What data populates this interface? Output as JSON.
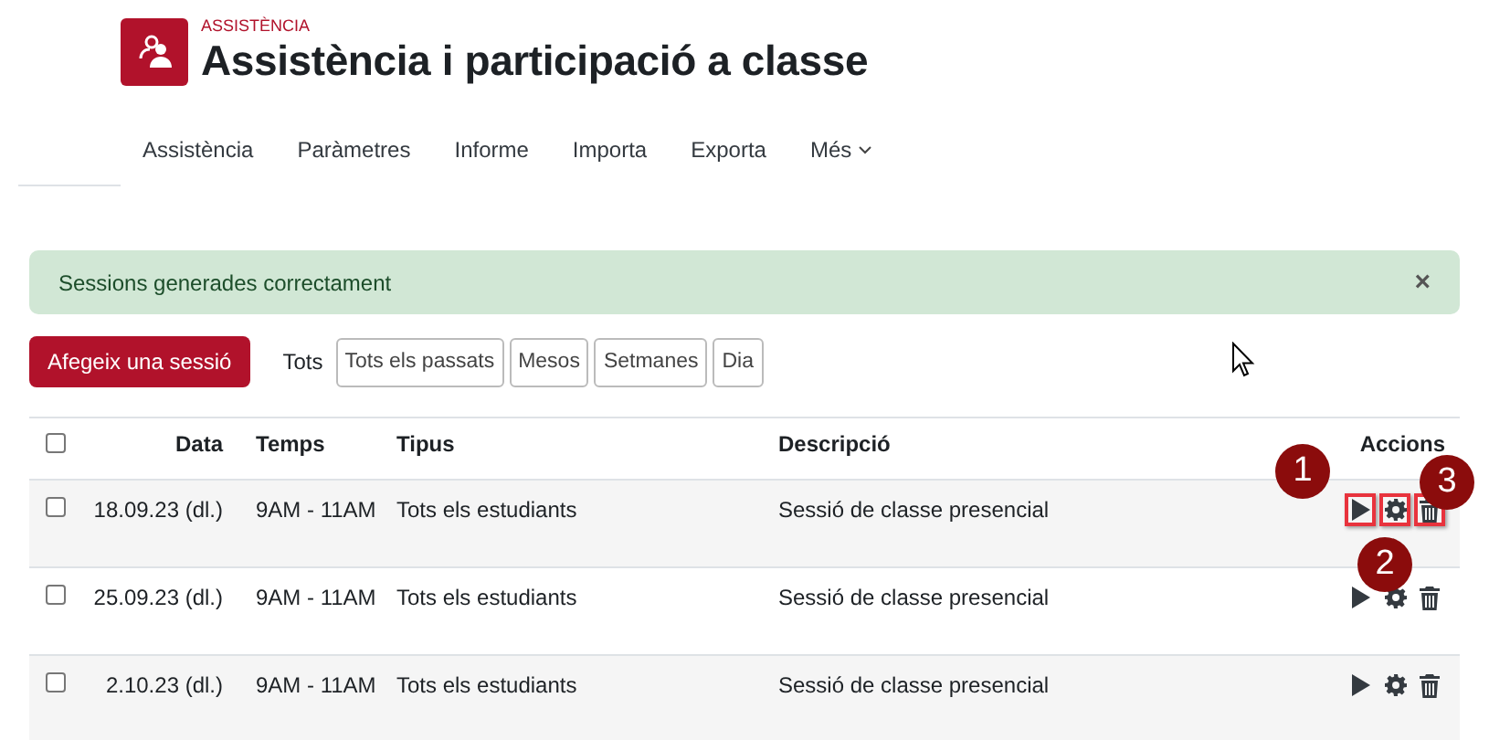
{
  "header": {
    "eyebrow": "ASSISTÈNCIA",
    "title": "Assistència i participació a classe"
  },
  "nav": [
    {
      "label": "Assistència",
      "dropdown": false
    },
    {
      "label": "Paràmetres",
      "dropdown": false
    },
    {
      "label": "Informe",
      "dropdown": false
    },
    {
      "label": "Importa",
      "dropdown": false
    },
    {
      "label": "Exporta",
      "dropdown": false
    },
    {
      "label": "Més",
      "dropdown": true
    }
  ],
  "alert": {
    "message": "Sessions generades correctament",
    "close": "×"
  },
  "toolbar": {
    "add_button": "Afegeix una sessió",
    "filter_label": "Tots",
    "filters": [
      {
        "label": "Tots els passats",
        "selected": false
      },
      {
        "label": "Mesos",
        "selected": false
      },
      {
        "label": "Setmanes",
        "selected": false
      },
      {
        "label": "Dia",
        "selected": false
      }
    ]
  },
  "table": {
    "columns": [
      "Data",
      "Temps",
      "Tipus",
      "Descripció",
      "Accions"
    ],
    "select_all_checked": false,
    "rows": [
      {
        "checked": false,
        "highlighted": true,
        "data": "18.09.23 (dl.)",
        "temps": "9AM - 11AM",
        "tipus": "Tots els estudiants",
        "descripcio": "Sessió de classe presencial"
      },
      {
        "checked": false,
        "highlighted": false,
        "data": "25.09.23 (dl.)",
        "temps": "9AM - 11AM",
        "tipus": "Tots els estudiants",
        "descripcio": "Sessió de classe presencial"
      },
      {
        "checked": false,
        "highlighted": false,
        "data": "2.10.23 (dl.)",
        "temps": "9AM - 11AM",
        "tipus": "Tots els estudiants",
        "descripcio": "Sessió de classe presencial"
      }
    ]
  },
  "callouts": [
    "1",
    "2",
    "3"
  ]
}
